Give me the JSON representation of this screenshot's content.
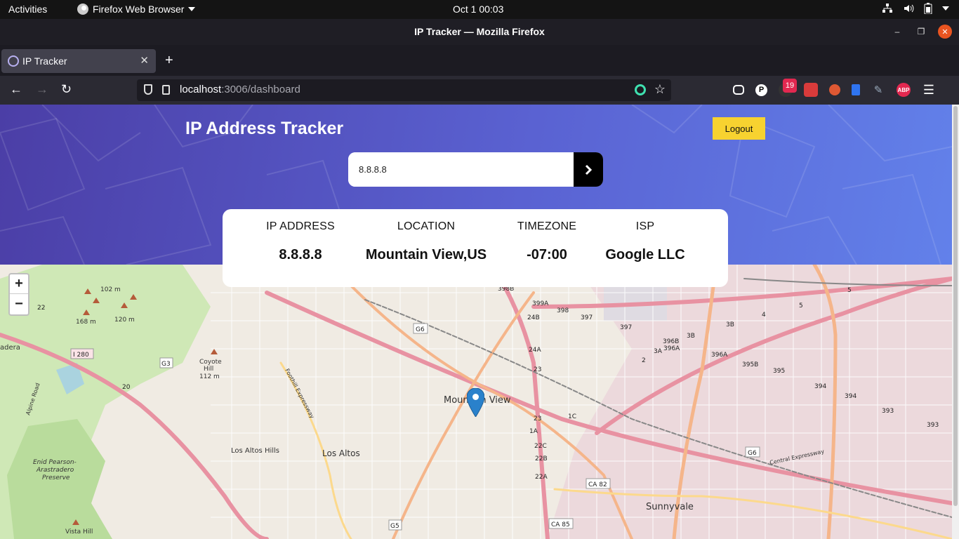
{
  "system": {
    "activities": "Activities",
    "app_name": "Firefox Web Browser",
    "clock": "Oct 1  00:03"
  },
  "window": {
    "title": "IP Tracker — Mozilla Firefox"
  },
  "tab": {
    "label": "IP Tracker"
  },
  "urlbar": {
    "host": "localhost",
    "path": ":3006/dashboard"
  },
  "toolbar": {
    "notification_badge": "19",
    "abp_label": "ABP",
    "p_label": "P"
  },
  "page": {
    "heading": "IP Address Tracker",
    "logout_label": "Logout",
    "search_value": "8.8.8.8",
    "info": {
      "ip_label": "IP ADDRESS",
      "ip_value": "8.8.8.8",
      "location_label": "LOCATION",
      "location_value": "Mountain View,US",
      "timezone_label": "TIMEZONE",
      "timezone_value": "-07:00",
      "isp_label": "ISP",
      "isp_value": "Google LLC"
    }
  },
  "map": {
    "zoom_in": "+",
    "zoom_out": "−",
    "labels": {
      "mountain_view": "Mountain View",
      "los_altos": "Los Altos",
      "los_altos_hills": "Los Altos Hills",
      "sunnyvale": "Sunnyvale",
      "coyote_hill": "Coyote",
      "coyote_hill_2": "Hill",
      "coyote_elev": "112 m",
      "enid_1": "Enid Pearson-",
      "enid_2": "Arastradero",
      "enid_3": "Preserve",
      "vista_hill": "Vista Hill",
      "elev_102": "102 m",
      "elev_168": "168 m",
      "elev_120": "120 m",
      "adera": "adera",
      "i280": "I 280",
      "g3": "G3",
      "g5": "G5",
      "g6_a": "G6",
      "g6_b": "G6",
      "ca82": "CA 82",
      "ca85": "CA 85",
      "r22": "22",
      "r20": "20",
      "foothill": "Foothill Expressway",
      "central": "Central Expressway",
      "alpine": "Alpine Road",
      "r23": "23",
      "r24a": "24A",
      "r24b": "24B",
      "r399a": "399A",
      "r398": "398",
      "r398b": "398B",
      "r397a": "397",
      "r397b": "397",
      "r396b": "396B",
      "r396a": "396A",
      "r396a2": "396A",
      "r395b": "395B",
      "r395": "395",
      "r394a": "394",
      "r394b": "394",
      "r393a": "393",
      "r393b": "393",
      "r3b": "3B",
      "r3b2": "3B",
      "r3a": "3A",
      "r2": "2",
      "r4": "4",
      "r5": "5",
      "r5b": "5",
      "r1c": "1C",
      "r22c": "22C",
      "r22b": "22B",
      "r22a": "22A",
      "r23b": "23",
      "r1a": "1A"
    }
  },
  "colors": {
    "hero_start": "#4b3ea6",
    "hero_end": "#6281ea",
    "logout_bg": "#f7d230",
    "pin": "#2a81cb"
  }
}
